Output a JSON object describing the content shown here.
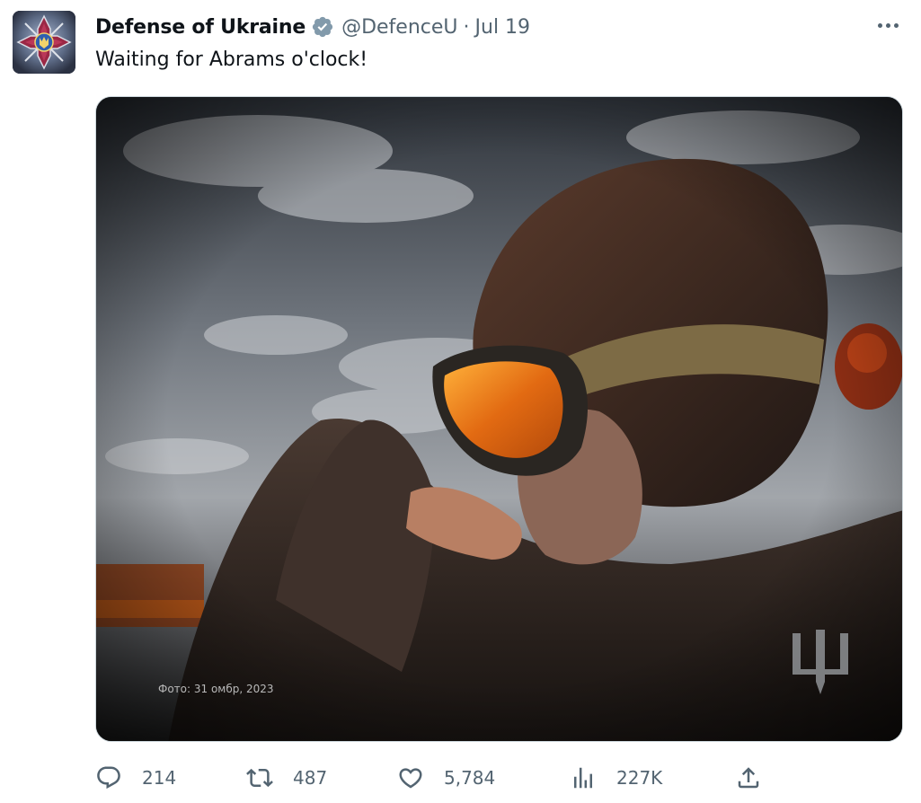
{
  "tweet": {
    "author": {
      "display_name": "Defense of Ukraine",
      "handle": "@DefenceU",
      "separator": "·",
      "date": "Jul 19",
      "verified_icon": "verified-badge-icon"
    },
    "text": "Waiting for Abrams o'clock!",
    "media": {
      "photo_caption": "Фото: 31 омбр, 2023"
    },
    "stats": {
      "replies": "214",
      "retweets": "487",
      "likes": "5,784",
      "views": "227K"
    },
    "icons": {
      "reply": "reply-icon",
      "retweet": "retweet-icon",
      "like": "heart-icon",
      "views": "views-icon",
      "share": "share-icon",
      "more": "more-options-icon"
    },
    "colors": {
      "text": "#0f1419",
      "secondary": "#536471",
      "verified": "#829aab"
    }
  }
}
